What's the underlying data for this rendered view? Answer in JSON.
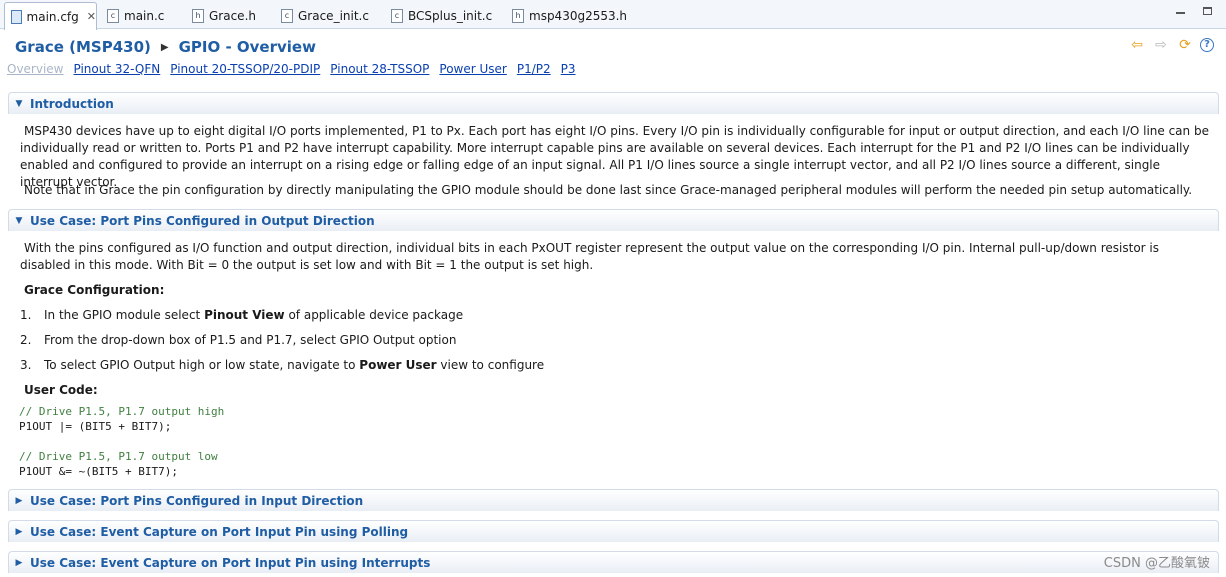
{
  "tabs": [
    {
      "label": "main.cfg",
      "icon": "cfg-file-icon",
      "active": true
    },
    {
      "label": "main.c",
      "icon": "c-file-icon"
    },
    {
      "label": "Grace.h",
      "icon": "h-file-icon"
    },
    {
      "label": "Grace_init.c",
      "icon": "c-file-icon"
    },
    {
      "label": "BCSplus_init.c",
      "icon": "c-file-icon"
    },
    {
      "label": "msp430g2553.h",
      "icon": "h-file-icon"
    }
  ],
  "header": {
    "breadcrumb_root": "Grace (MSP430)",
    "page_title": "GPIO - Overview"
  },
  "links": [
    "Overview",
    "Pinout 32-QFN",
    "Pinout 20-TSSOP/20-PDIP",
    "Pinout 28-TSSOP",
    "Power User",
    "P1/P2",
    "P3"
  ],
  "sections": {
    "intro": {
      "title": "Introduction",
      "p1": "MSP430 devices have up to eight digital I/O ports implemented, P1 to Px. Each port has eight I/O pins. Every I/O pin is individually configurable for input or output direction, and each I/O line can be individually read or written to. Ports P1 and P2 have interrupt capability. More interrupt capable pins are available on several devices. Each interrupt for the P1 and P2 I/O lines can be individually enabled and configured to provide an interrupt on a rising edge or falling edge of an input signal. All P1 I/O lines source a single interrupt vector, and all P2 I/O lines source a different, single interrupt vector.",
      "p2": "Note that in Grace the pin configuration by directly manipulating the GPIO module should be done last since Grace-managed peripheral modules will perform the needed pin setup automatically."
    },
    "output": {
      "title": "Use Case: Port Pins Configured in Output Direction",
      "p1": "With the pins configured as I/O function and output direction, individual bits in each PxOUT register represent the output value on the corresponding I/O pin. Internal pull-up/down resistor is disabled in this mode. With Bit = 0 the output is set low and with Bit = 1 the output is set high.",
      "config_heading": "Grace Configuration:",
      "steps": [
        {
          "num": "1.",
          "pre": "In the GPIO module select ",
          "bold": "Pinout View",
          "post": " of applicable device package"
        },
        {
          "num": "2.",
          "pre": "From the drop-down box of P1.5 and P1.7, select GPIO Output option",
          "bold": "",
          "post": ""
        },
        {
          "num": "3.",
          "pre": "To select GPIO Output high or low state, navigate to ",
          "bold": "Power User",
          "post": " view to configure"
        }
      ],
      "code_heading": "User Code:",
      "code": {
        "c1": "// Drive P1.5, P1.7 output high",
        "l1": "P1OUT |= (BIT5 + BIT7);",
        "c2": "// Drive P1.5, P1.7 output low",
        "l2": "P1OUT &= ~(BIT5 + BIT7);"
      }
    },
    "input": {
      "title": "Use Case: Port Pins Configured in Input Direction"
    },
    "polling": {
      "title": "Use Case: Event Capture on Port Input Pin using Polling"
    },
    "interrupts": {
      "title": "Use Case: Event Capture on Port Input Pin using Interrupts"
    }
  },
  "watermark": "CSDN @乙酸氧铍"
}
